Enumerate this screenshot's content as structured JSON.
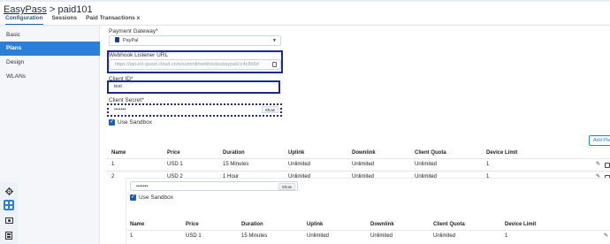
{
  "header": {
    "brand": "EasyPass",
    "separator": " > ",
    "page_name": "paid101"
  },
  "tabs": [
    {
      "label": "Configuration"
    },
    {
      "label": "Sessions"
    },
    {
      "label": "Paid Transactions"
    }
  ],
  "tab_close_glyph": "x",
  "sidebar": {
    "items": [
      {
        "label": "Basic"
      },
      {
        "label": "Plans"
      },
      {
        "label": "Design"
      },
      {
        "label": "WLANs"
      }
    ]
  },
  "form": {
    "gateway_label": "Payment Gateway*",
    "gateway_value": "PayPal",
    "webhook_label": "Webhook Listener URL",
    "webhook_value": "https://api.ecl-guest.cloud.com/summit/webhooks/paypal/cc4c8b9d",
    "client_id_label": "Client ID*",
    "client_id_value": "test",
    "client_secret_label": "Client Secret*",
    "client_secret_value": "•••••••",
    "show_label": "Show",
    "sandbox_label": "Use Sandbox"
  },
  "overlay_form": {
    "client_secret_value": "•••••••",
    "show_label": "Show",
    "sandbox_label": "Use Sandbox"
  },
  "add_plan_label": "Add Plan",
  "table": {
    "columns": [
      "Name",
      "Price",
      "Duration",
      "Uplink",
      "Downlink",
      "Client Quota",
      "Device Limit"
    ],
    "rows": [
      [
        "1",
        "USD 1",
        "15 Minutes",
        "Unlimited",
        "Unlimited",
        "Unlimited",
        "1"
      ],
      [
        "2",
        "USD 2",
        "1 Hour",
        "Unlimited",
        "Unlimited",
        "Unlimited",
        "1"
      ]
    ]
  },
  "overlay_table": {
    "columns": [
      "Name",
      "Price",
      "Duration",
      "Uplink",
      "Downlink",
      "Client Quota",
      "Device Limit"
    ],
    "rows": [
      [
        "1",
        "USD 1",
        "15 Minutes",
        "Unlimited",
        "Unlimited",
        "Unlimited",
        "1"
      ]
    ]
  },
  "colors": {
    "accent": "#2b7fd8",
    "highlight_box": "#1c2a8f"
  },
  "icons": {
    "iconbar": [
      "gear-icon",
      "grid-icon",
      "camera-icon",
      "building-icon"
    ],
    "row_actions": [
      "edit-icon",
      "delete-icon"
    ]
  }
}
